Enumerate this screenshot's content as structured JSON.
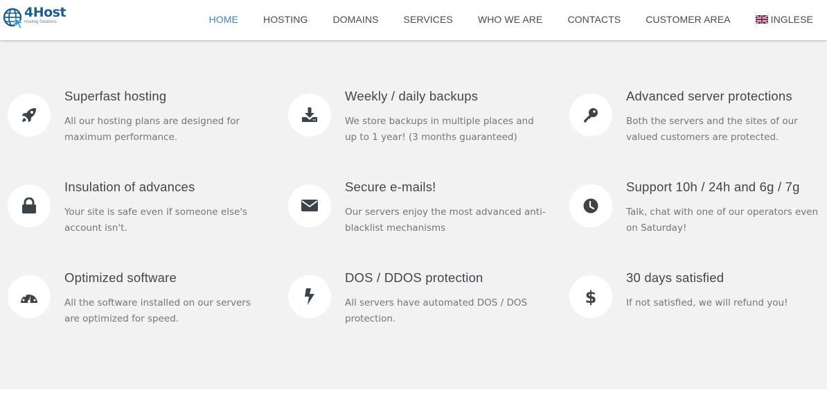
{
  "brand": {
    "name": "4Host",
    "tagline": "Hosting Solutions",
    "logo_icon": "globe-cursor-icon",
    "primary_color": "#1e5d8c"
  },
  "nav": {
    "items": [
      {
        "label": "HOME",
        "active": true
      },
      {
        "label": "HOSTING",
        "active": false
      },
      {
        "label": "DOMAINS",
        "active": false
      },
      {
        "label": "SERVICES",
        "active": false
      },
      {
        "label": "WHO WE ARE",
        "active": false
      },
      {
        "label": "CONTACTS",
        "active": false
      },
      {
        "label": "CUSTOMER AREA",
        "active": false
      }
    ],
    "language": {
      "label": "INGLESE",
      "icon": "uk-flag-icon"
    },
    "active_color": "#3a86c8"
  },
  "features": [
    {
      "icon": "rocket-icon",
      "title": "Superfast hosting",
      "desc": "All our hosting plans are designed for maximum performance."
    },
    {
      "icon": "download-icon",
      "title": "Weekly / daily backups",
      "desc": "We store backups in multiple places and up to 1 year! (3 months guaranteed)"
    },
    {
      "icon": "key-icon",
      "title": "Advanced server protections",
      "desc": "Both the servers and the sites of our valued customers are protected."
    },
    {
      "icon": "lock-icon",
      "title": "Insulation of advances",
      "desc": "Your site is safe even if someone else's account isn't."
    },
    {
      "icon": "envelope-icon",
      "title": "Secure e-mails!",
      "desc": "Our servers enjoy the most advanced anti-blacklist mechanisms"
    },
    {
      "icon": "clock-icon",
      "title": "Support 10h / 24h and 6g / 7g",
      "desc": "Talk, chat with one of our operators even on Saturday!"
    },
    {
      "icon": "dashboard-icon",
      "title": "Optimized software",
      "desc": "All the software installed on our servers are optimized for speed."
    },
    {
      "icon": "bolt-icon",
      "title": "DOS / DDOS protection",
      "desc": "All servers have automated DOS / DOS protection."
    },
    {
      "icon": "dollar-icon",
      "title": "30 days satisfied",
      "desc": "If not satisfied, we will refund you!"
    }
  ]
}
